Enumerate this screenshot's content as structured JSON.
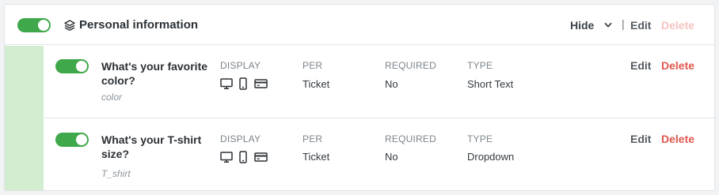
{
  "section": {
    "title": "Personal information",
    "hide_label": "Hide",
    "separator": "|",
    "edit_label": "Edit",
    "delete_label": "Delete",
    "enabled": true
  },
  "columns": {
    "display": "DISPLAY",
    "per": "PER",
    "required": "REQUIRED",
    "type": "TYPE"
  },
  "questions": [
    {
      "question": "What's your favorite color?",
      "key": "color",
      "enabled": true,
      "display_icons": [
        "desktop-icon",
        "mobile-icon",
        "card-icon"
      ],
      "per": "Ticket",
      "required": "No",
      "type": "Short Text",
      "edit_label": "Edit",
      "delete_label": "Delete"
    },
    {
      "question": "What's your T-shirt size?",
      "key": "T_shirt",
      "enabled": true,
      "display_icons": [
        "desktop-icon",
        "mobile-icon",
        "card-icon"
      ],
      "per": "Ticket",
      "required": "No",
      "type": "Dropdown",
      "edit_label": "Edit",
      "delete_label": "Delete"
    }
  ],
  "colors": {
    "toggle_on": "#3fa84a",
    "stripe": "#d3edd0",
    "delete_active": "#e0584f",
    "delete_disabled": "#f5c4c0"
  }
}
